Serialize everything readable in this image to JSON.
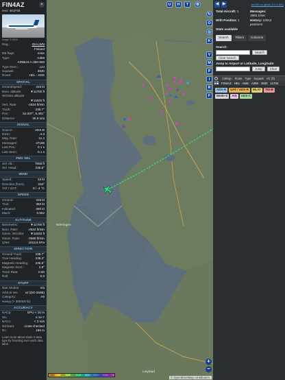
{
  "aircraft": {
    "callsign": "FIN4AZ",
    "hex_line": "Hex: 461F55",
    "close": "×",
    "image_credit": "Image © 8315"
  },
  "details": [
    {
      "k": "Reg.:",
      "v": "OH-LWN",
      "link": true
    },
    {
      "k": "",
      "v": "Finland"
    },
    {
      "k": "DB flags:",
      "v": "none"
    },
    {
      "k": "Type:",
      "v": "A359"
    },
    {
      "k": "",
      "v": "AIRBUS A-350-900"
    },
    {
      "k": "Type Desc.:",
      "v": "L2J"
    },
    {
      "k": "Squawk:",
      "v": "3530"
    },
    {
      "k": "Route:",
      "v": "HEL - AMS"
    }
  ],
  "sections": {
    "spatial": "SPATIAL",
    "signal": "SIGNAL",
    "fms": "FMS SEL",
    "wind": "WIND",
    "speed": "SPEED",
    "altitude": "ALTITUDE",
    "direction": "DIRECTION",
    "stuff": "STUFF",
    "accuracy": "ACCURACY"
  },
  "spatial": [
    {
      "k": "Groundspeed:",
      "v": "316 kt"
    },
    {
      "k": "Baro. altitude:",
      "v": "▼11700 ft"
    },
    {
      "k": "WGS84 altitude:",
      "v": ""
    },
    {
      "k": "",
      "v": "▼11625 ft"
    },
    {
      "k": "Vert. Rate:",
      "v": "-2624 ft/min"
    },
    {
      "k": "Track:",
      "v": "238.7°"
    },
    {
      "k": "Pos.:",
      "v": "52.637°, 5.491°"
    },
    {
      "k": "Distance:",
      "v": "25.9 nmi"
    }
  ],
  "signal": [
    {
      "k": "Source:",
      "v": "ADS-B"
    },
    {
      "k": "RSSI:",
      "v": "-4.3"
    },
    {
      "k": "Msg. Rate:",
      "v": "11.4"
    },
    {
      "k": "Messages:",
      "v": "47196"
    },
    {
      "k": "Last Pos.:",
      "v": "0.1 s"
    },
    {
      "k": "Last Seen:",
      "v": "0.1 s"
    }
  ],
  "fms": [
    {
      "k": "Sel. Alt.:",
      "v": "7008 ft"
    },
    {
      "k": "Sel. Head.:",
      "v": "235.5°"
    }
  ],
  "wind": [
    {
      "k": "Speed:",
      "v": "34 kt"
    },
    {
      "k": "Direction (from):",
      "v": "234°"
    },
    {
      "k": "TAT / OAT:",
      "v": "8 / -4 °C"
    }
  ],
  "speed": [
    {
      "k": "Ground:",
      "v": "316 kt"
    },
    {
      "k": "True:",
      "v": "350 kt"
    },
    {
      "k": "Indicated:",
      "v": "290 kt"
    },
    {
      "k": "Mach:",
      "v": "0.552"
    }
  ],
  "altitude": [
    {
      "k": "Barometric:",
      "v": "▼11700 ft"
    },
    {
      "k": "Baro. Rate:",
      "v": "-2624 ft/min"
    },
    {
      "k": "Geom. WGS84:",
      "v": "▼11625 ft"
    },
    {
      "k": "Geom. Rate:",
      "v": "-2560 ft/min"
    },
    {
      "k": "QNH:",
      "v": "1013.6 hPa"
    }
  ],
  "direction": [
    {
      "k": "Ground Track:",
      "v": "238.7°"
    },
    {
      "k": "True Heading:",
      "v": "238.3°"
    },
    {
      "k": "Magnetic Heading:",
      "v": "235.5°"
    },
    {
      "k": "Magnetic Decl.:",
      "v": "2.9°"
    },
    {
      "k": "Track Rate:",
      "v": "0.00"
    },
    {
      "k": "Roll:",
      "v": "0.0"
    }
  ],
  "stuff": [
    {
      "k": "Nav. Modes:",
      "v": "n/a"
    },
    {
      "k": "ADS-B Ver.:",
      "v": "v2 (DO-260B)"
    },
    {
      "k": "Category:",
      "v": "A5"
    },
    {
      "k": "Heavy (> 300000 lb)",
      "v": ""
    }
  ],
  "accuracy": [
    {
      "k": "NACp:",
      "v": "EPU < 10 m"
    },
    {
      "k": "SIL:",
      "v": "≤ 1e-7"
    },
    {
      "k": "NACv:",
      "v": "< 3 m/s"
    },
    {
      "k": "NICbaro:",
      "v": "cross-checked"
    },
    {
      "k": "Rc:",
      "v": "186 m"
    }
  ],
  "footnote": "Learn more about Mode S data type by hovering over each data label.",
  "map": {
    "buttons_top": [
      "U",
      "H",
      "T"
    ],
    "buttons_side": [
      "O",
      "K",
      "V",
      "M",
      "P",
      "I",
      "R",
      "F"
    ],
    "places": [
      "Wieringen",
      "Lelystad"
    ],
    "alt_labels": [
      "2000",
      "4000",
      "6000",
      "10k",
      "20k",
      "30k",
      "40k+"
    ],
    "attribution": "© OpenStreetMap contributors.",
    "zoom_in": "+",
    "zoom_out": "−"
  },
  "right": {
    "version": "tar1090 on github (3.14.1581)",
    "stats": [
      {
        "k": "Total Aircraft:",
        "v": "1"
      },
      {
        "k": "Messages:",
        "v": "1883.1/sec"
      },
      {
        "k": "With Position:",
        "v": "1"
      },
      {
        "k": "History:",
        "v": "22512 positions"
      }
    ],
    "stats_note": "Stats available",
    "tabs": [
      "Search",
      "Filters",
      "Columns"
    ],
    "search_label": "Search:",
    "search_button": "Search",
    "clear_search": "Clear Search",
    "jump_label": "Jump to Airport or Latitude, Longitude:",
    "jump_button": "Jump",
    "clear_button": "Clear",
    "columns": [
      "Callsign",
      "Route",
      "Type",
      "Squawk",
      "Alt. (ft)"
    ],
    "row": {
      "callsign": "FIN4AZ",
      "route": "HEL - AMS",
      "type": "A359",
      "squawk": "3530",
      "alt": "11700"
    },
    "legend": [
      {
        "label": "ADS-B",
        "bg": "#a4c7e8",
        "fg": "#1b2f44"
      },
      {
        "label": "UAT / ADS-R",
        "bg": "#e6b55a",
        "fg": "#3a2600"
      },
      {
        "label": "MLAT",
        "bg": "#e6d07a",
        "fg": "#3a3000"
      },
      {
        "label": "TIS-B",
        "bg": "#e79a9a",
        "fg": "#3d0a0a"
      },
      {
        "label": "Mode-S",
        "bg": "#d7d9db",
        "fg": "#1c1e20"
      },
      {
        "label": "AIS",
        "bg": "#e9c7e8",
        "fg": "#3b1d3b"
      },
      {
        "label": "ADS-C",
        "bg": "#a9d9a4",
        "fg": "#173a13"
      }
    ]
  },
  "colors": {
    "panel_bg": "#1f2428",
    "section_fg": "#8fc4ee",
    "accent": "#1c4d9a",
    "map_land": "#6c7a5f",
    "map_water": "#5b6e7c"
  }
}
